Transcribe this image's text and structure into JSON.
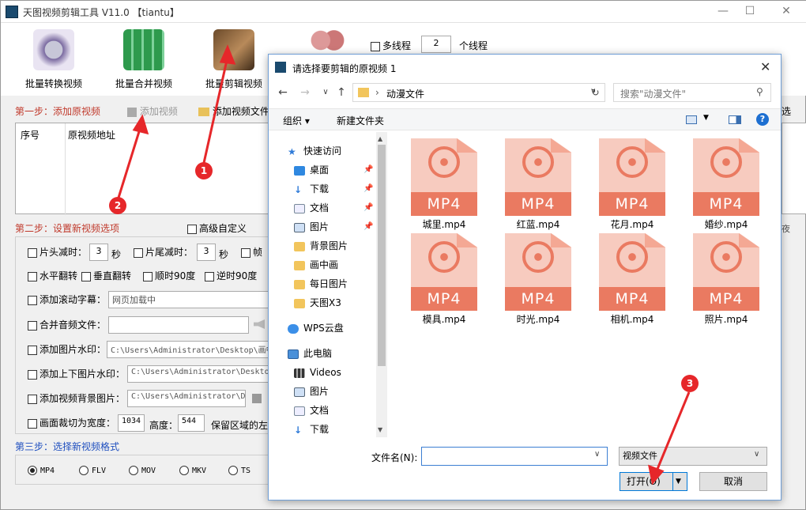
{
  "app": {
    "title": "天图视频剪辑工具 V11.0 【tiantu】"
  },
  "toolbar": {
    "batch_convert": "批量转换视频",
    "batch_merge": "批量合并视频",
    "batch_edit": "批量剪辑视频",
    "multithread_label": "多线程",
    "threads_value": "2",
    "threads_suffix": "个线程"
  },
  "step1": {
    "title": "第一步：添加原视频",
    "add_video": "添加视频",
    "add_folder": "添加视频文件",
    "col_no": "序号",
    "col_path": "原视频地址",
    "right_cut": "选"
  },
  "step2": {
    "title": "第二步：设置新视频选项",
    "advanced": "高级自定义",
    "head_cut": "片头减时：",
    "head_val": "3",
    "sec1": "秒",
    "tail_cut": "片尾减时：",
    "tail_val": "3",
    "sec2": "秒",
    "frame": "帧",
    "hflip": "水平翻转",
    "vflip": "垂直翻转",
    "cw90": "顺时90度",
    "ccw90": "逆时90度",
    "scroll_sub": "添加滚动字幕：",
    "scroll_val": "网页加载中",
    "merge_audio": "合并音频文件：",
    "img_watermark": "添加图片水印：",
    "img_watermark_path": "C:\\Users\\Administrator\\Desktop\\画中",
    "tb_watermark": "添加上下图片水印：",
    "tb_watermark_path": "C:\\Users\\Administrator\\Desktop\\",
    "bg_image": "添加视频背景图片：",
    "bg_image_path": "C:\\Users\\Administrator\\D",
    "crop": "画面裁切为宽度：",
    "crop_w": "1034",
    "height_label": "高度：",
    "crop_h": "544",
    "keep_label": "保留区域的左上"
  },
  "step3": {
    "title": "第三步：选择新视频格式",
    "formats": [
      "MP4",
      "FLV",
      "MOV",
      "MKV",
      "TS"
    ],
    "selected": "MP4"
  },
  "dialog": {
    "title": "请选择要剪辑的原视频 1",
    "path": "动漫文件",
    "search_placeholder": "搜索\"动漫文件\"",
    "organize": "组织 ▾",
    "new_folder": "新建文件夹",
    "nav": [
      {
        "label": "快速访问"
      },
      {
        "label": "桌面"
      },
      {
        "label": "下载"
      },
      {
        "label": "文档"
      },
      {
        "label": "图片"
      },
      {
        "label": "背景图片"
      },
      {
        "label": "画中画"
      },
      {
        "label": "每日图片"
      },
      {
        "label": "天图X3"
      },
      {
        "label": "WPS云盘"
      },
      {
        "label": "此电脑"
      },
      {
        "label": "Videos"
      },
      {
        "label": "图片"
      },
      {
        "label": "文档"
      },
      {
        "label": "下载"
      }
    ],
    "files": [
      "城里.mp4",
      "红蓝.mp4",
      "花月.mp4",
      "婚纱.mp4",
      "模具.mp4",
      "时光.mp4",
      "相机.mp4",
      "照片.mp4"
    ],
    "file_badge": "MP4",
    "filename_label": "文件名(N):",
    "filetype": "视频文件",
    "open": "打开(O)",
    "cancel": "取消"
  },
  "markers": [
    "1",
    "2",
    "3"
  ],
  "colors": {
    "step_red": "#c0392b",
    "step_blue": "#1f4fbf",
    "marker": "#e6272a",
    "file_accent": "#ea7a61"
  }
}
